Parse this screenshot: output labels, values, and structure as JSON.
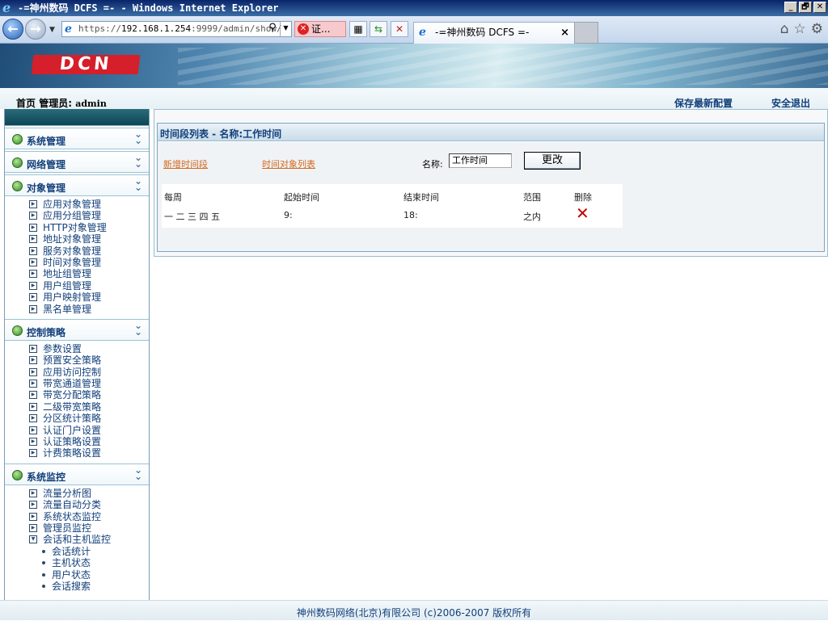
{
  "window": {
    "title": "-=神州数码 DCFS =- - Windows Internet Explorer",
    "buttons": {
      "minimize": "_",
      "maximize": "🗗",
      "close": "✕"
    }
  },
  "browser": {
    "url_prefix": "https://",
    "url_host": "192.168.1.254",
    "url_rest": ":9999/admin/show/",
    "cert_label": "证...",
    "tab_title": "-=神州数码 DCFS =-",
    "tab_close": "×"
  },
  "banner": {
    "logo_text": "DCN"
  },
  "header": {
    "home_label": "首页",
    "admin_label": "管理员:",
    "admin_name": "admin",
    "save_config": "保存最新配置",
    "logout": "安全退出"
  },
  "sidebar": {
    "groups": [
      {
        "label": "系统管理",
        "items": []
      },
      {
        "label": "网络管理",
        "items": []
      },
      {
        "label": "对象管理",
        "items": [
          "应用对象管理",
          "应用分组管理",
          "HTTP对象管理",
          "地址对象管理",
          "服务对象管理",
          "时间对象管理",
          "地址组管理",
          "用户组管理",
          "用户映射管理",
          "黑名单管理"
        ]
      },
      {
        "label": "控制策略",
        "items": [
          "参数设置",
          "预置安全策略",
          "应用访问控制",
          "带宽通道管理",
          "带宽分配策略",
          "二级带宽策略",
          "分区统计策略",
          "认证门户设置",
          "认证策略设置",
          "计费策略设置"
        ]
      },
      {
        "label": "系统监控",
        "items": [
          "流量分析图",
          "流量自动分类",
          "系统状态监控",
          "管理员监控",
          "会话和主机监控"
        ],
        "subitems": [
          "会话统计",
          "主机状态",
          "用户状态",
          "会话搜索"
        ]
      }
    ]
  },
  "main": {
    "panel_title": "时间段列表 - 名称:工作时间",
    "link_new": "新增时间段",
    "link_list": "时间对象列表",
    "name_label": "名称:",
    "name_value": "工作时间",
    "change_button": "更改",
    "table": {
      "headers": [
        "每周",
        "起始时间",
        "结束时间",
        "范围",
        "删除"
      ],
      "rows": [
        {
          "week": "一 二 三 四 五",
          "start": "9:",
          "end": "18:",
          "range": "之内",
          "delete": "✕"
        }
      ]
    }
  },
  "footer": {
    "copyright": "神州数码网络(北京)有限公司 (c)2006-2007 版权所有"
  }
}
